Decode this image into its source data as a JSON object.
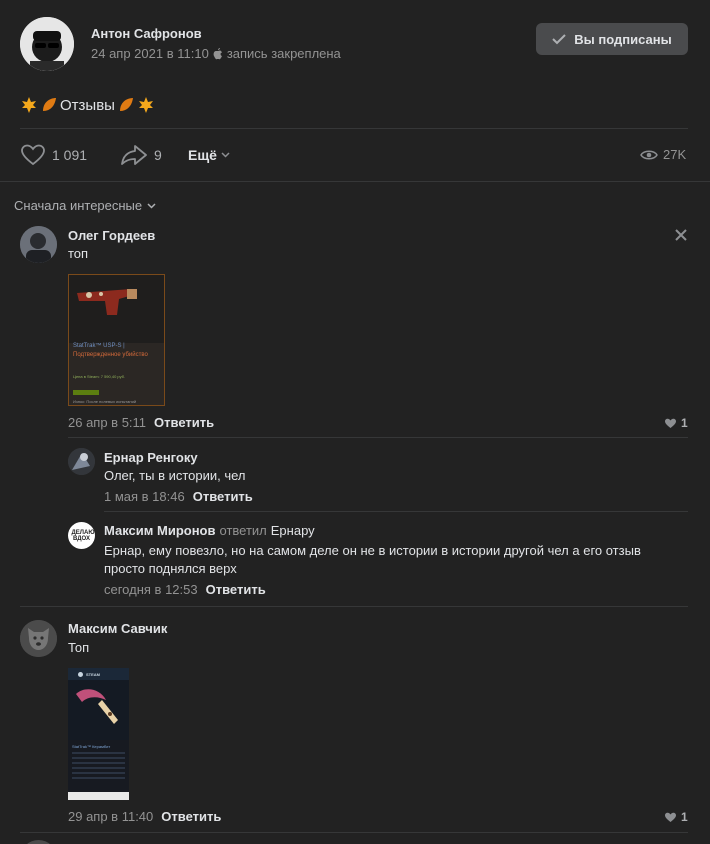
{
  "post": {
    "author": "Антон Сафронов",
    "date": "24 апр 2021 в 11:10",
    "pinned": "запись закреплена",
    "subscribe_label": "Вы подписаны",
    "text": "Отзывы",
    "likes": "1 091",
    "shares": "9",
    "more_label": "Ещё",
    "views": "27K"
  },
  "comments_sort": "Сначала интересные",
  "comments": [
    {
      "author": "Олег Гордеев",
      "text": "топ",
      "date": "26 апр в 5:11",
      "reply_label": "Ответить",
      "likes": "1",
      "attachment": {
        "line1": "StatTrak™ USP-S |",
        "line2": "Подтвержденное убийство",
        "line3": "Цена в Steam: 7 590,40 руб.",
        "line4": "Износ: После полевых испытаний"
      }
    },
    {
      "author": "Ернар Ренгоку",
      "text": "Олег, ты в истории, чел",
      "date": "1 мая в 18:46",
      "reply_label": "Ответить"
    },
    {
      "author": "Максим Миронов",
      "replied": "ответил",
      "replied_to": "Ернару",
      "avatar_text": "ДЕЛАЮ ВДОХ",
      "text": "Ернар, ему повезло, но на самом деле он не в истории в истории другой чел а его отзыв просто поднялся верх",
      "date": "сегодня в 12:53",
      "reply_label": "Ответить"
    },
    {
      "author": "Максим Савчик",
      "text": "Топ",
      "date": "29 апр в 11:40",
      "reply_label": "Ответить",
      "likes": "1",
      "attachment": {
        "app": "STEAM",
        "line1": "StatTrak™ Керамбит"
      }
    }
  ],
  "colors": {
    "background": "#222222",
    "separator": "#363738",
    "muted": "#939393",
    "button": "#4a4b4d"
  }
}
